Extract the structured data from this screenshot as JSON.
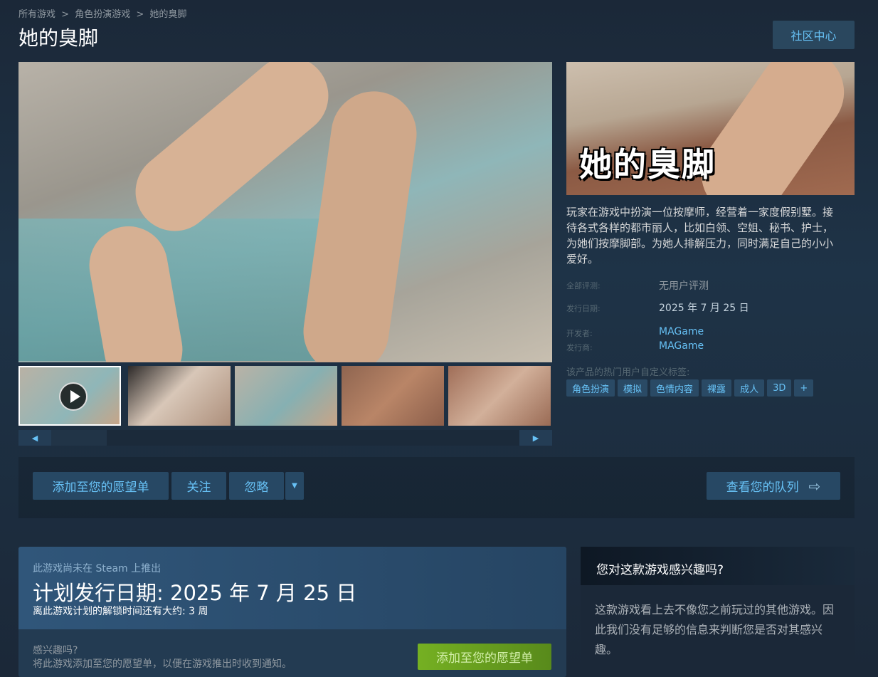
{
  "breadcrumb": [
    "所有游戏",
    "角色扮演游戏",
    "她的臭脚"
  ],
  "breadcrumb_sep": ">",
  "title": "她的臭脚",
  "community_button": "社区中心",
  "capsule_logo_text": "她的臭脚",
  "description": "玩家在游戏中扮演一位按摩师，经营着一家度假别墅。接待各式各样的都市丽人，比如白领、空姐、秘书、护士，为她们按摩脚部。为她人排解压力，同时满足自己的小小爱好。",
  "meta": {
    "reviews_label": "全部评测:",
    "reviews_value": "无用户评测",
    "release_label": "发行日期:",
    "release_value": "2025 年 7 月 25 日",
    "developer_label": "开发者:",
    "developer_value": "MAGame",
    "publisher_label": "发行商:",
    "publisher_value": "MAGame"
  },
  "tags_label": "该产品的热门用户自定义标签:",
  "tags": [
    "角色扮演",
    "模拟",
    "色情内容",
    "裸露",
    "成人",
    "3D",
    "+"
  ],
  "slider": {
    "left": "◀",
    "right": "▶"
  },
  "actions": {
    "wishlist": "添加至您的愿望单",
    "follow": "关注",
    "ignore": "忽略",
    "dropdown": "▼",
    "queue": "查看您的队列",
    "queue_arrow": "⇨"
  },
  "release": {
    "note": "此游戏尚未在 Steam 上推出",
    "date": "计划发行日期: 2025 年 7 月 25 日",
    "unlock": "离此游戏计划的解锁时间还有大约: 3 周",
    "interest": "感兴趣吗?",
    "interest_desc": "将此游戏添加至您的愿望单，以便在游戏推出时收到通知。",
    "wishlist_button": "添加至您的愿望单"
  },
  "interest": {
    "title": "您对这款游戏感兴趣吗?",
    "body": "这款游戏看上去不像您之前玩过的其他游戏。因此我们没有足够的信息来判断您是否对其感兴趣。"
  },
  "colors": {
    "accent_blue": "#67c1f5",
    "button_bg": "#274864",
    "green_button": "#75b022",
    "page_bg": "#1b2838"
  }
}
